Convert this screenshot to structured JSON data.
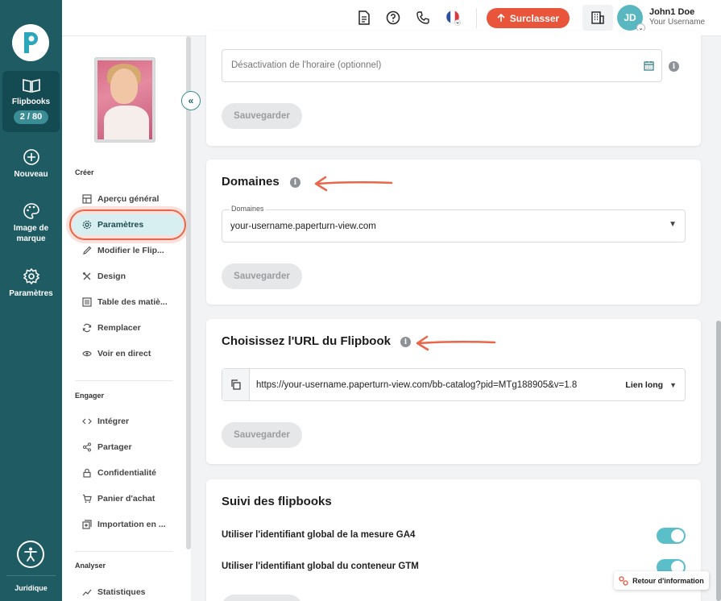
{
  "rail": {
    "items": [
      {
        "label": "Flipbooks",
        "counter": "2 / 80",
        "icon": "book-open-icon"
      },
      {
        "label": "Nouveau",
        "icon": "plus-circle-icon"
      },
      {
        "label": "Image de marque",
        "icon": "palette-icon"
      },
      {
        "label": "Paramètres",
        "icon": "gear-icon"
      }
    ],
    "legal": "Juridique",
    "accent": "#1e5b63"
  },
  "topbar": {
    "upgrade_label": "Surclasser",
    "upgrade_color": "#e8553b",
    "user_initials": "JD",
    "user_name": "John1 Doe",
    "user_sub": "Your Username"
  },
  "sidebar": {
    "sections": [
      {
        "title": "Créer",
        "items": [
          "Aperçu général",
          "Paramètres",
          "Modifier le Flip...",
          "Design",
          "Table des matiè...",
          "Remplacer",
          "Voir en direct"
        ]
      },
      {
        "title": "Engager",
        "items": [
          "Intégrer",
          "Partager",
          "Confidentialité",
          "Panier d'achat",
          "Importation en ..."
        ]
      },
      {
        "title": "Analyser",
        "items": [
          "Statistiques"
        ]
      }
    ],
    "active_item": "Paramètres"
  },
  "schedule": {
    "placeholder": "Désactivation de l'horaire (optionnel)",
    "save_label": "Sauvegarder"
  },
  "domains": {
    "title": "Domaines",
    "field_label": "Domaines",
    "value": "your-username.paperturn-view.com",
    "save_label": "Sauvegarder"
  },
  "url": {
    "title": "Choisissez l'URL du Flipbook",
    "value": "https://your-username.paperturn-view.com/bb-catalog?pid=MTg188905&v=1.8",
    "mode": "Lien long",
    "save_label": "Sauvegarder"
  },
  "tracking": {
    "title": "Suivi des flipbooks",
    "options": [
      {
        "label": "Utiliser l'identifiant global de la mesure GA4",
        "on": true
      },
      {
        "label": "Utiliser l'identifiant global du conteneur GTM",
        "on": true
      }
    ]
  },
  "feedback_label": "Retour d'information"
}
